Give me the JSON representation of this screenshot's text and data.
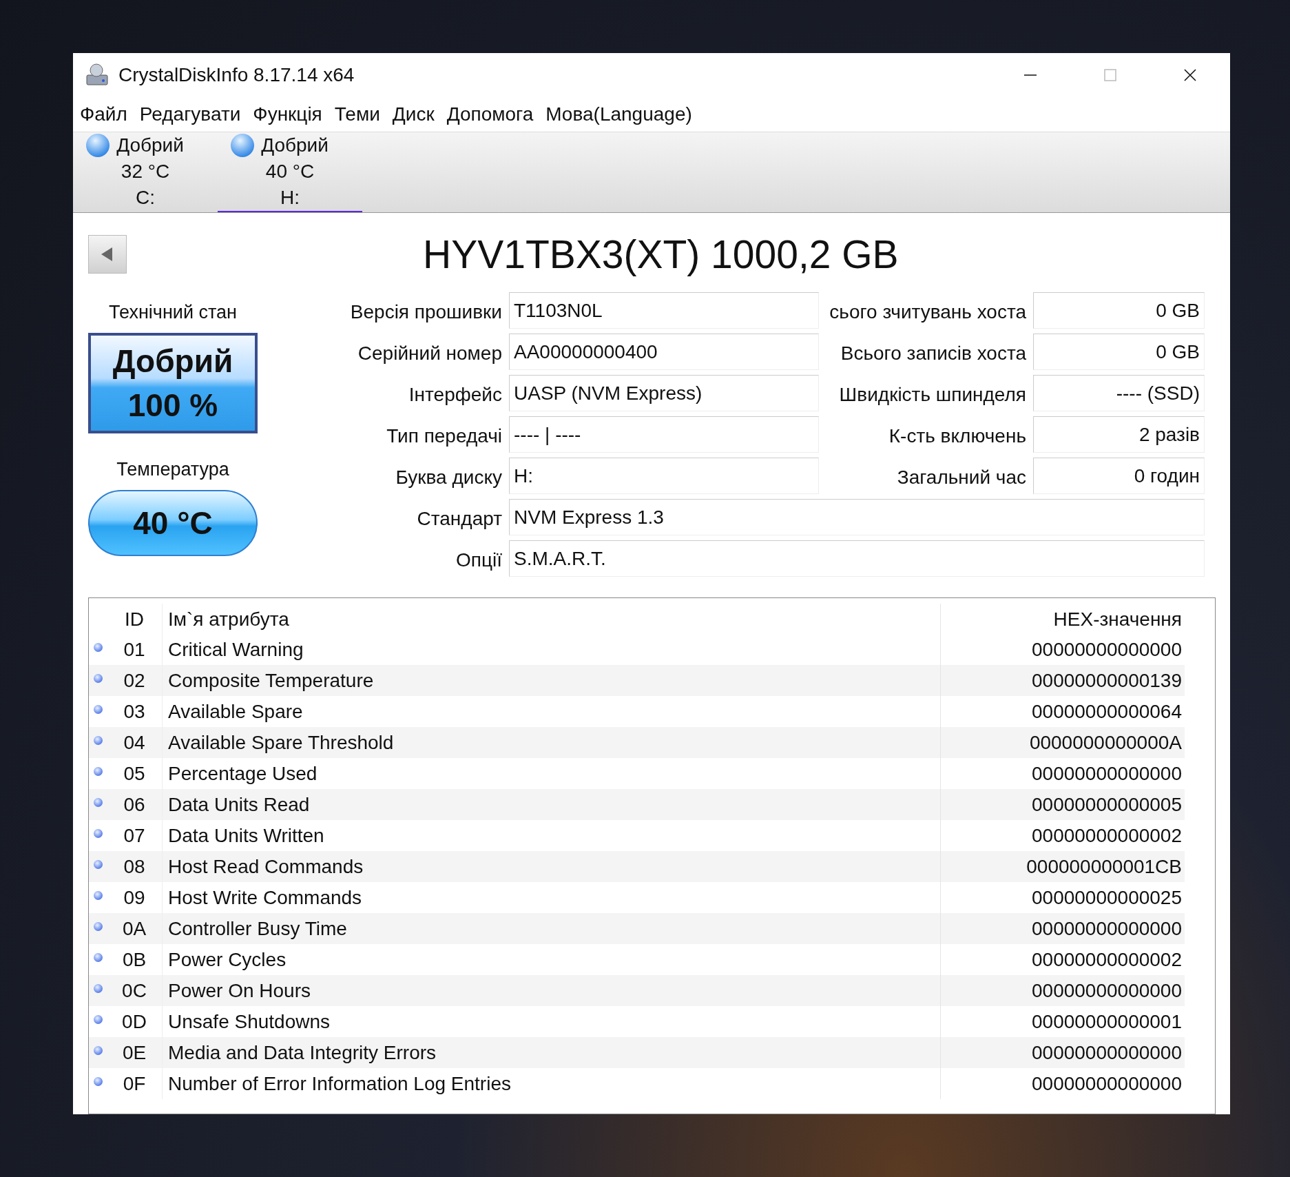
{
  "window": {
    "title": "CrystalDiskInfo 8.17.14 x64"
  },
  "menu": [
    "Файл",
    "Редагувати",
    "Функція",
    "Теми",
    "Диск",
    "Допомога",
    "Мова(Language)"
  ],
  "disks": [
    {
      "status": "Добрий",
      "temperature": "32 °C",
      "letter": "C:",
      "selected": false
    },
    {
      "status": "Добрий",
      "temperature": "40 °C",
      "letter": "H:",
      "selected": true
    }
  ],
  "model": "HYV1TBX3(XT) 1000,2 GB",
  "health": {
    "label": "Технічний стан",
    "status": "Добрий",
    "percent": "100 %"
  },
  "temperature": {
    "label": "Температура",
    "value": "40 °C"
  },
  "fields_left": [
    {
      "label": "Версія прошивки",
      "value": "T1103N0L"
    },
    {
      "label": "Серійний номер",
      "value": "AA00000000400"
    },
    {
      "label": "Інтерфейс",
      "value": "UASP (NVM Express)"
    },
    {
      "label": "Тип передачі",
      "value": "---- | ----"
    },
    {
      "label": "Буква диску",
      "value": "H:"
    }
  ],
  "fields_right": [
    {
      "label": "сього зчитувань хоста",
      "value": "0 GB"
    },
    {
      "label": "Всього записів хоста",
      "value": "0 GB"
    },
    {
      "label": "Швидкість шпинделя",
      "value": "---- (SSD)"
    },
    {
      "label": "К-сть включень",
      "value": "2 разів"
    },
    {
      "label": "Загальний час",
      "value": "0 годин"
    }
  ],
  "fields_wide": [
    {
      "label": "Стандарт",
      "value": "NVM Express 1.3"
    },
    {
      "label": "Опції",
      "value": "S.M.A.R.T."
    }
  ],
  "table": {
    "columns": [
      "ID",
      "Ім`я атрибута",
      "HEX-значення"
    ],
    "rows": [
      {
        "id": "01",
        "name": "Critical Warning",
        "raw": "00000000000000"
      },
      {
        "id": "02",
        "name": "Composite Temperature",
        "raw": "00000000000139"
      },
      {
        "id": "03",
        "name": "Available Spare",
        "raw": "00000000000064"
      },
      {
        "id": "04",
        "name": "Available Spare Threshold",
        "raw": "0000000000000A"
      },
      {
        "id": "05",
        "name": "Percentage Used",
        "raw": "00000000000000"
      },
      {
        "id": "06",
        "name": "Data Units Read",
        "raw": "00000000000005"
      },
      {
        "id": "07",
        "name": "Data Units Written",
        "raw": "00000000000002"
      },
      {
        "id": "08",
        "name": "Host Read Commands",
        "raw": "000000000001CB"
      },
      {
        "id": "09",
        "name": "Host Write Commands",
        "raw": "00000000000025"
      },
      {
        "id": "0A",
        "name": "Controller Busy Time",
        "raw": "00000000000000"
      },
      {
        "id": "0B",
        "name": "Power Cycles",
        "raw": "00000000000002"
      },
      {
        "id": "0C",
        "name": "Power On Hours",
        "raw": "00000000000000"
      },
      {
        "id": "0D",
        "name": "Unsafe Shutdowns",
        "raw": "00000000000001"
      },
      {
        "id": "0E",
        "name": "Media and Data Integrity Errors",
        "raw": "00000000000000"
      },
      {
        "id": "0F",
        "name": "Number of Error Information Log Entries",
        "raw": "00000000000000"
      }
    ]
  }
}
